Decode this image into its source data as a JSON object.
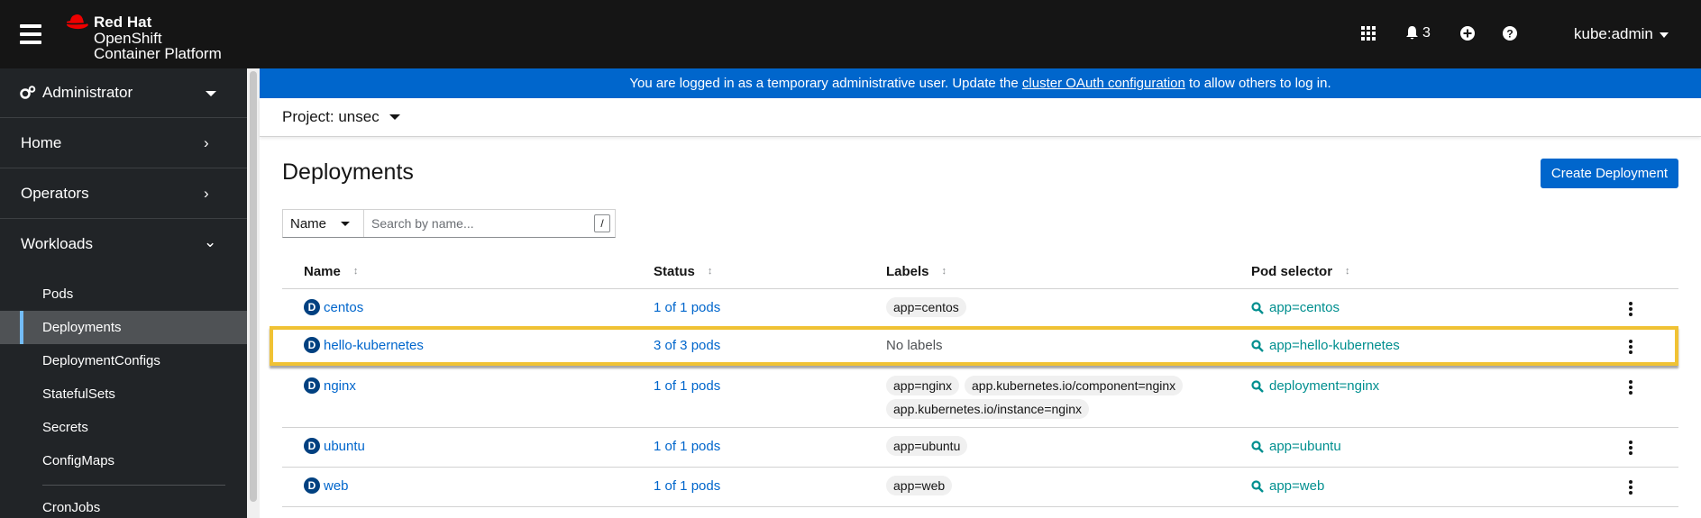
{
  "masthead": {
    "brand_line1": "Red Hat",
    "brand_line2": "OpenShift",
    "brand_line3": "Container Platform",
    "notifications_count": "3",
    "user": "kube:admin"
  },
  "sidebar": {
    "perspective": "Administrator",
    "sections": [
      {
        "label": "Home"
      },
      {
        "label": "Operators"
      },
      {
        "label": "Workloads"
      }
    ],
    "workloads_items": [
      {
        "label": "Pods"
      },
      {
        "label": "Deployments"
      },
      {
        "label": "DeploymentConfigs"
      },
      {
        "label": "StatefulSets"
      },
      {
        "label": "Secrets"
      },
      {
        "label": "ConfigMaps"
      },
      {
        "label": "CronJobs"
      }
    ]
  },
  "banner": {
    "text_before": "You are logged in as a temporary administrative user. Update the ",
    "link": "cluster OAuth configuration",
    "text_after": " to allow others to log in."
  },
  "project": {
    "label": "Project: unsec"
  },
  "page": {
    "title": "Deployments",
    "create_button": "Create Deployment"
  },
  "filter": {
    "type": "Name",
    "placeholder": "Search by name...",
    "shortcut": "/"
  },
  "table": {
    "columns": [
      "Name",
      "Status",
      "Labels",
      "Pod selector"
    ],
    "rows": [
      {
        "badge": "D",
        "name": "centos",
        "status": "1 of 1 pods",
        "labels": [
          "app=centos"
        ],
        "no_labels": "",
        "selector": "app=centos"
      },
      {
        "badge": "D",
        "name": "hello-kubernetes",
        "status": "3 of 3 pods",
        "labels": [],
        "no_labels": "No labels",
        "selector": "app=hello-kubernetes"
      },
      {
        "badge": "D",
        "name": "nginx",
        "status": "1 of 1 pods",
        "labels": [
          "app=nginx",
          "app.kubernetes.io/component=nginx",
          "app.kubernetes.io/instance=nginx"
        ],
        "no_labels": "",
        "selector": "deployment=nginx"
      },
      {
        "badge": "D",
        "name": "ubuntu",
        "status": "1 of 1 pods",
        "labels": [
          "app=ubuntu"
        ],
        "no_labels": "",
        "selector": "app=ubuntu"
      },
      {
        "badge": "D",
        "name": "web",
        "status": "1 of 1 pods",
        "labels": [
          "app=web"
        ],
        "no_labels": "",
        "selector": "app=web"
      }
    ]
  },
  "icons": {
    "hamburger": "hamburger-menu-icon",
    "apps": "app-launcher-icon",
    "bell": "bell-icon",
    "add": "plus-circle-icon",
    "help": "question-circle-icon",
    "search": "search-icon",
    "kebab": "kebab-icon",
    "cogs": "cogs-icon"
  },
  "colors": {
    "masthead": "#151515",
    "sidebar": "#212427",
    "banner": "#0066cc",
    "link": "#0066cc",
    "selector": "#008f8f",
    "highlight": "#f0c234"
  }
}
